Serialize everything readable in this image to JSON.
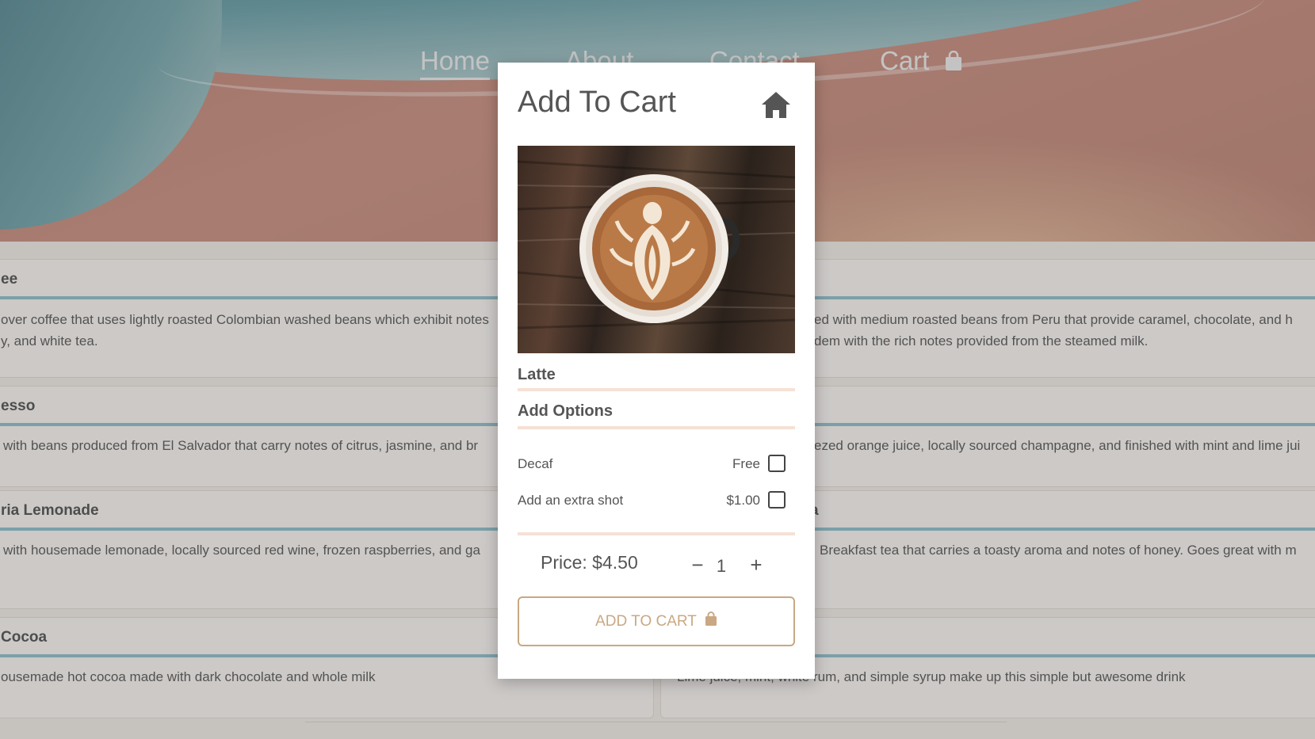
{
  "nav": {
    "home": "Home",
    "about": "About",
    "contact": "Contact",
    "cart": "Cart"
  },
  "menu": {
    "items": [
      {
        "title": "ee",
        "desc_line1": "over coffee that uses lightly roasted Colombian washed beans which exhibit notes",
        "desc_line2": "y, and white tea."
      },
      {
        "title": "",
        "desc_line1": "ed with medium roasted beans from Peru that provide caramel, chocolate, and h",
        "desc_line2": "dem with the rich notes provided from the steamed milk."
      },
      {
        "title": "esso",
        "desc_line1": "with beans produced from El Salvador that carry notes of citrus, jasmine, and br",
        "desc_line2": ""
      },
      {
        "title": "",
        "desc_line1": "ezed orange juice, locally sourced champagne, and finished with mint and lime jui",
        "desc_line2": ""
      },
      {
        "title": "ria Lemonade",
        "desc_line1": "with housemade lemonade, locally sourced red wine, frozen raspberries, and ga",
        "desc_line2": ""
      },
      {
        "title": "a",
        "desc_line1": "Breakfast tea that carries a toasty aroma and notes of honey. Goes great with m",
        "desc_line2": ""
      },
      {
        "title": "Cocoa",
        "desc_line1": "ousemade hot cocoa made with dark chocolate and whole milk",
        "desc_line2": ""
      },
      {
        "title": "",
        "desc_line1": "Lime juice, mint, white rum, and simple syrup make up this simple but awesome drink",
        "desc_line2": ""
      }
    ]
  },
  "modal": {
    "title": "Add To Cart",
    "home_icon": "home-icon",
    "product_name": "Latte",
    "options_heading": "Add Options",
    "options": [
      {
        "label": "Decaf",
        "price": "Free",
        "checked": false
      },
      {
        "label": "Add an extra shot",
        "price": "$1.00",
        "checked": false
      }
    ],
    "price": "Price: $4.50",
    "quantity": "1",
    "minus": "−",
    "plus": "+",
    "add_button": "ADD TO CART"
  },
  "colors": {
    "accent": "#c9a883",
    "divider": "#f6e1d6",
    "menu_rule": "#7ab3c0"
  }
}
